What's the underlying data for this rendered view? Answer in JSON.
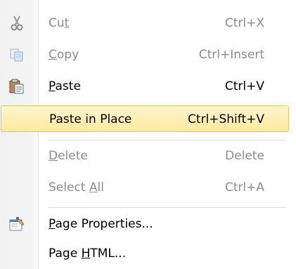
{
  "menu": {
    "items": [
      {
        "label_pre": "Cu",
        "label_acc": "t",
        "label_post": "",
        "shortcut": "Ctrl+X",
        "icon": "cut-icon",
        "enabled": false
      },
      {
        "label_pre": "",
        "label_acc": "C",
        "label_post": "opy",
        "shortcut": "Ctrl+Insert",
        "icon": "copy-icon",
        "enabled": false
      },
      {
        "label_pre": "",
        "label_acc": "P",
        "label_post": "aste",
        "shortcut": "Ctrl+V",
        "icon": "paste-icon",
        "enabled": true
      },
      {
        "label_pre": "Paste in Place",
        "label_acc": "",
        "label_post": "",
        "shortcut": "Ctrl+Shift+V",
        "icon": "",
        "enabled": true,
        "highlighted": true
      },
      {
        "label_pre": "",
        "label_acc": "D",
        "label_post": "elete",
        "shortcut": "Delete",
        "icon": "",
        "enabled": false
      },
      {
        "label_pre": "Select ",
        "label_acc": "A",
        "label_post": "ll",
        "shortcut": "Ctrl+A",
        "icon": "",
        "enabled": false
      },
      {
        "label_pre": "",
        "label_acc": "P",
        "label_post": "age Properties...",
        "shortcut": "",
        "icon": "page-properties-icon",
        "enabled": true
      },
      {
        "label_pre": "Page ",
        "label_acc": "H",
        "label_post": "TML...",
        "shortcut": "",
        "icon": "",
        "enabled": true
      }
    ]
  }
}
